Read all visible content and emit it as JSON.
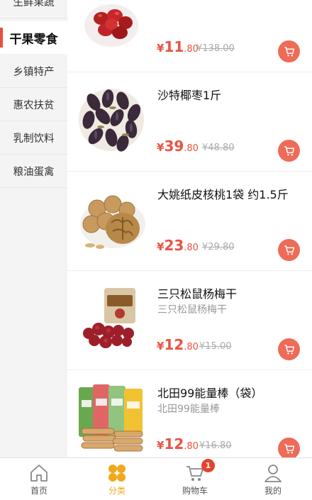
{
  "sidebar": {
    "items": [
      {
        "label": "生鲜果蔬"
      },
      {
        "label": "干果零食",
        "active": true
      },
      {
        "label": "乡镇特产"
      },
      {
        "label": "惠农扶贫"
      },
      {
        "label": "乳制饮料"
      },
      {
        "label": "粮油蛋禽"
      }
    ]
  },
  "products": [
    {
      "name": "",
      "subtitle": "",
      "currency": "¥",
      "price_int": "11",
      "price_dec": ".80",
      "old_price": "¥138.00"
    },
    {
      "name": "沙特椰枣1斤",
      "subtitle": "",
      "currency": "¥",
      "price_int": "39",
      "price_dec": ".80",
      "old_price": "¥48.80"
    },
    {
      "name": "大姚纸皮核桃1袋 约1.5斤",
      "subtitle": "",
      "currency": "¥",
      "price_int": "23",
      "price_dec": ".80",
      "old_price": "¥29.80"
    },
    {
      "name": "三只松鼠杨梅干",
      "subtitle": "三只松鼠杨梅干",
      "currency": "¥",
      "price_int": "12",
      "price_dec": ".80",
      "old_price": "¥15.00"
    },
    {
      "name": "北田99能量棒（袋）",
      "subtitle": "北田99能量棒",
      "currency": "¥",
      "price_int": "12",
      "price_dec": ".80",
      "old_price": "¥16.80"
    }
  ],
  "tabbar": {
    "items": [
      {
        "label": "首页",
        "icon": "home-icon"
      },
      {
        "label": "分类",
        "icon": "category-icon",
        "active": true
      },
      {
        "label": "购物车",
        "icon": "cart-icon",
        "badge": "1"
      },
      {
        "label": "我的",
        "icon": "user-icon"
      }
    ]
  },
  "colors": {
    "accent": "#ea5342",
    "cart_button": "#ee6b58",
    "tab_active": "#f2a81d",
    "badge": "#e5432f",
    "sidebar_bg": "#f4f4f4"
  }
}
